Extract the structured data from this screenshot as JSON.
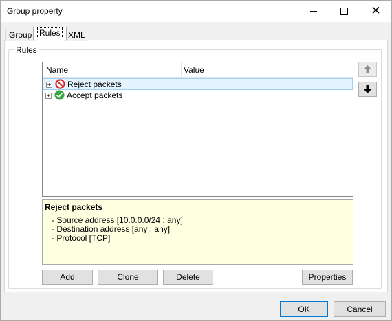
{
  "window": {
    "title": "Group property"
  },
  "tabs": [
    {
      "label": "Group",
      "active": false
    },
    {
      "label": "Rules",
      "active": true
    },
    {
      "label": "XML",
      "active": false
    }
  ],
  "rules_group": {
    "label": "Rules"
  },
  "tree": {
    "columns": [
      "Name",
      "Value"
    ],
    "rows": [
      {
        "label": "Reject packets",
        "icon": "no-entry-icon",
        "expander": "+",
        "selected": true
      },
      {
        "label": "Accept packets",
        "icon": "checkmark-icon",
        "expander": "+",
        "selected": false
      }
    ]
  },
  "description": {
    "title": "Reject packets",
    "lines": [
      "- Source address [10.0.0.0/24 : any]",
      "- Destination address [any : any]",
      "- Protocol [TCP]"
    ]
  },
  "buttons": {
    "add": "Add",
    "clone": "Clone",
    "delete": "Delete",
    "properties": "Properties",
    "ok": "OK",
    "cancel": "Cancel"
  },
  "colors": {
    "selection": "#e5f3ff",
    "description_bg": "#ffffe1",
    "reject_red": "#d9262c",
    "accept_green": "#3aa543",
    "default_button_border": "#0078d7"
  }
}
